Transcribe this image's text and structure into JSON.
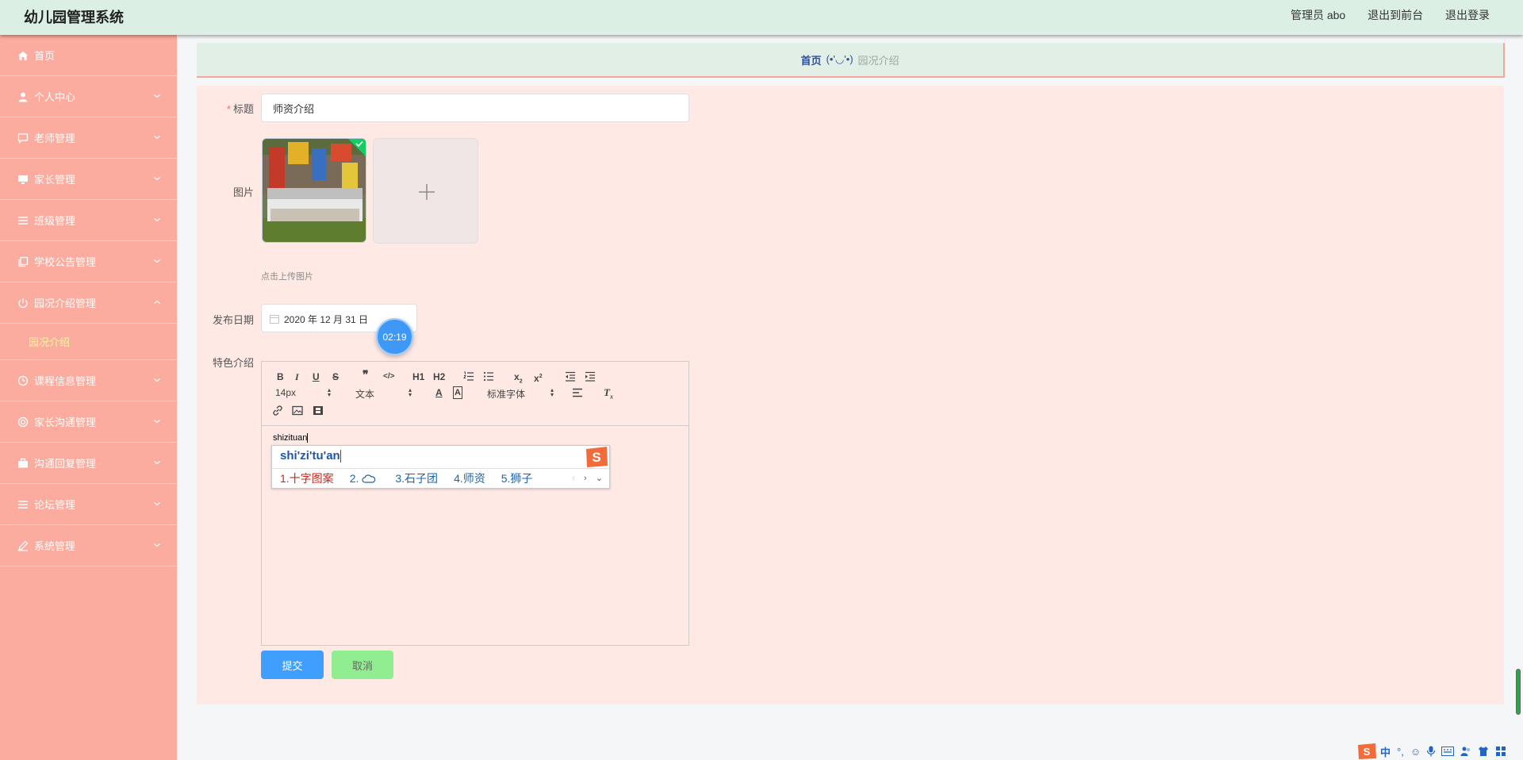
{
  "app": {
    "title": "幼儿园管理系统"
  },
  "header": {
    "user": "管理员 abo",
    "to_front": "退出到前台",
    "logout": "退出登录"
  },
  "sidebar": {
    "items": [
      {
        "label": "首页",
        "icon": "home-icon"
      },
      {
        "label": "个人中心",
        "icon": "user-icon"
      },
      {
        "label": "老师管理",
        "icon": "chat-icon"
      },
      {
        "label": "家长管理",
        "icon": "monitor-icon"
      },
      {
        "label": "班级管理",
        "icon": "menu-icon"
      },
      {
        "label": "学校公告管理",
        "icon": "copy-icon"
      },
      {
        "label": "园况介绍管理",
        "icon": "power-icon",
        "expanded": true,
        "sub": "园况介绍"
      },
      {
        "label": "课程信息管理",
        "icon": "clock-icon"
      },
      {
        "label": "家长沟通管理",
        "icon": "circle-icon"
      },
      {
        "label": "沟通回复管理",
        "icon": "briefcase-icon"
      },
      {
        "label": "论坛管理",
        "icon": "menu-icon"
      },
      {
        "label": "系统管理",
        "icon": "edit-icon"
      }
    ]
  },
  "breadcrumb": {
    "home": "首页",
    "face": "(•'◡'•)",
    "current": "园况介绍"
  },
  "form": {
    "title_label": "标题",
    "title_value": "师资介绍",
    "image_label": "图片",
    "upload_hint": "点击上传图片",
    "date_label": "发布日期",
    "date_value": "2020 年 12 月 31 日",
    "feature_label": "特色介绍",
    "editor_text": "shizituan",
    "submit": "提交",
    "cancel": "取消"
  },
  "timer": {
    "text": "02:19"
  },
  "toolbar": {
    "font_size": "14px",
    "heading": "文本",
    "font_family": "标准字体",
    "h1": "H1",
    "h2": "H2"
  },
  "ime": {
    "input": "shi'zi'tu'an",
    "candidates": [
      "1.十字图案",
      "2.",
      "3.石子团",
      "4.师资",
      "5.狮子"
    ]
  },
  "tray": {
    "lang": "中",
    "punct": "°,"
  },
  "colors": {
    "sidebar": "#fcac9f",
    "header": "#dcefe5",
    "panel": "#ffe9e5",
    "primary": "#409eff",
    "cancel": "#90ee90"
  }
}
